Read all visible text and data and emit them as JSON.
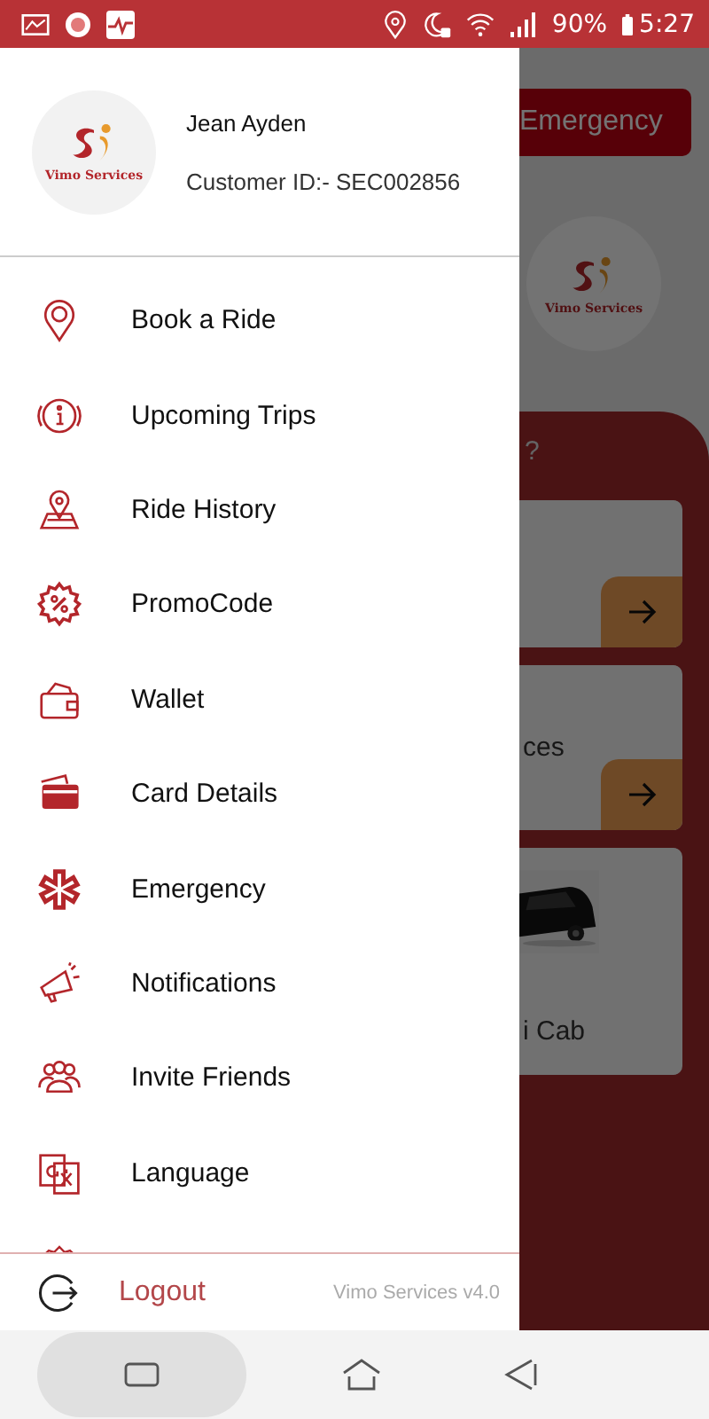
{
  "status_bar": {
    "battery": "90%",
    "time": "5:27"
  },
  "profile": {
    "logo_text": "Vimo Services",
    "name": "Jean Ayden",
    "customer_id": "Customer ID:- SEC002856"
  },
  "menu": [
    {
      "label": "Book a Ride",
      "kind": "pin"
    },
    {
      "label": "Upcoming Trips",
      "kind": "info"
    },
    {
      "label": "Ride History",
      "kind": "map"
    },
    {
      "label": "PromoCode",
      "kind": "promo"
    },
    {
      "label": "Wallet",
      "kind": "wallet"
    },
    {
      "label": "Card Details",
      "kind": "card"
    },
    {
      "label": "Emergency",
      "kind": "medical"
    },
    {
      "label": "Notifications",
      "kind": "megaphone"
    },
    {
      "label": "Invite Friends",
      "kind": "people"
    },
    {
      "label": "Language",
      "kind": "translate"
    }
  ],
  "footer": {
    "logout": "Logout",
    "version": "Vimo Services v4.0"
  },
  "background": {
    "emergency_button": "Emergency",
    "logo_text": "Vimo Services",
    "question_fragment": "?",
    "card_fragment": "ces",
    "cab_fragment": "i Cab"
  }
}
